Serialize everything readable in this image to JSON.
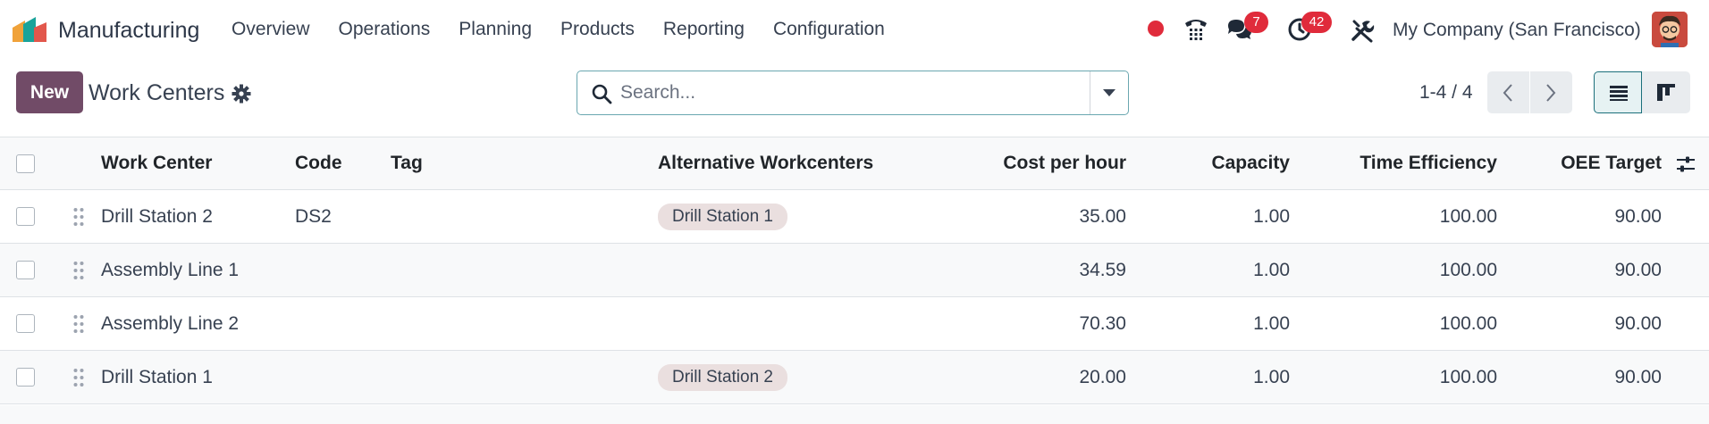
{
  "navbar": {
    "app_name": "Manufacturing",
    "menu": [
      "Overview",
      "Operations",
      "Planning",
      "Products",
      "Reporting",
      "Configuration"
    ],
    "messages_count": "7",
    "activities_count": "42",
    "company": "My Company (San Francisco)"
  },
  "control_panel": {
    "new_label": "New",
    "title": "Work Centers",
    "search_placeholder": "Search...",
    "pager": "1-4 / 4"
  },
  "table": {
    "columns": [
      "Work Center",
      "Code",
      "Tag",
      "Alternative Workcenters",
      "Cost per hour",
      "Capacity",
      "Time Efficiency",
      "OEE Target"
    ],
    "rows": [
      {
        "name": "Drill Station 2",
        "code": "DS2",
        "tag": "",
        "alternative": "Drill Station 1",
        "cost": "35.00",
        "capacity": "1.00",
        "efficiency": "100.00",
        "oee": "90.00"
      },
      {
        "name": "Assembly Line 1",
        "code": "",
        "tag": "",
        "alternative": "",
        "cost": "34.59",
        "capacity": "1.00",
        "efficiency": "100.00",
        "oee": "90.00"
      },
      {
        "name": "Assembly Line 2",
        "code": "",
        "tag": "",
        "alternative": "",
        "cost": "70.30",
        "capacity": "1.00",
        "efficiency": "100.00",
        "oee": "90.00"
      },
      {
        "name": "Drill Station 1",
        "code": "",
        "tag": "",
        "alternative": "Drill Station 2",
        "cost": "20.00",
        "capacity": "1.00",
        "efficiency": "100.00",
        "oee": "90.00"
      }
    ]
  },
  "colors": {
    "brand": "#714b67",
    "accent": "#1b6f7b",
    "badge": "#e02b3b",
    "tag_bg": "#eadfdf"
  },
  "icons": [
    "app-logo-icon",
    "record-dot-icon",
    "phone-icon",
    "chat-icon",
    "activity-clock-icon",
    "tools-icon",
    "gear-icon",
    "search-icon",
    "caret-down-icon",
    "chevron-left-icon",
    "chevron-right-icon",
    "list-view-icon",
    "kanban-view-icon",
    "drag-handle-icon",
    "optional-columns-icon"
  ]
}
